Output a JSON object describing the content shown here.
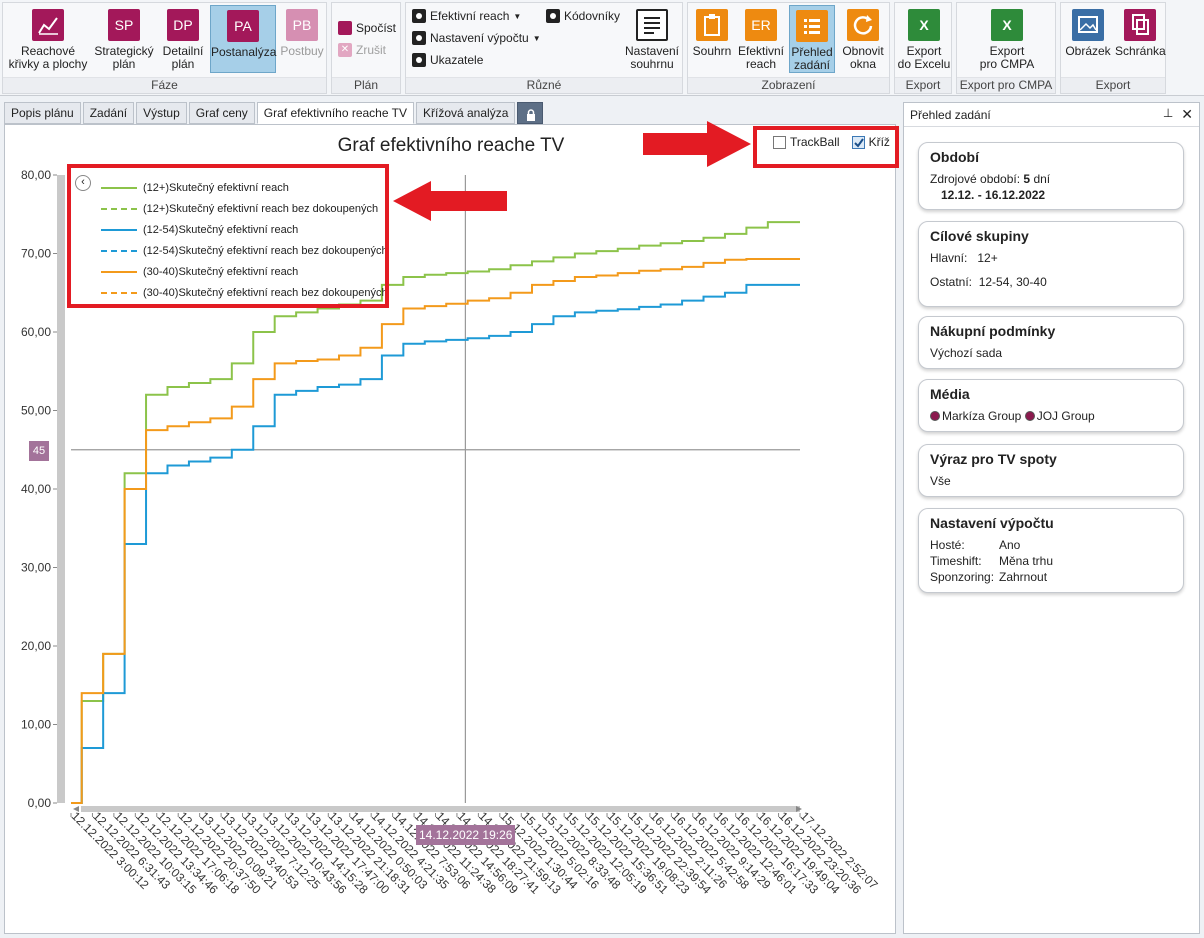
{
  "ribbon": {
    "groups": {
      "faze": "Fáze",
      "plan": "Plán",
      "ruzne": "Různé",
      "zobrazeni": "Zobrazení",
      "export1": "Export",
      "export_cmpa": "Export pro CMPA",
      "export2": "Export"
    },
    "reach_curves": {
      "line1": "Reachové",
      "line2": "křivky a plochy"
    },
    "strategic": {
      "code": "SP",
      "line1": "Strategický",
      "line2": "plán"
    },
    "detailed": {
      "code": "DP",
      "line1": "Detailní",
      "line2": "plán"
    },
    "postanalyza": {
      "code": "PA",
      "line1": "Postanalýza"
    },
    "postbuy": {
      "code": "PB",
      "line1": "Postbuy"
    },
    "spocist": "Spočíst",
    "zrusit": "Zrušit",
    "efektivni_reach": "Efektivní reach",
    "nastaveni_vypoctu": "Nastavení výpočtu",
    "ukazatele": "Ukazatele",
    "kodovniky": "Kódovníky",
    "nastaveni_souhrnu": {
      "line1": "Nastavení",
      "line2": "souhrnu"
    },
    "souhrn": "Souhrn",
    "efektivni_reach_view": {
      "code": "ER",
      "line1": "Efektivní",
      "line2": "reach"
    },
    "prehled_zadani": {
      "line1": "Přehled",
      "line2": "zadání"
    },
    "obnovit_okna": {
      "line1": "Obnovit",
      "line2": "okna"
    },
    "export_excel": {
      "line1": "Export",
      "line2": "do Excelu"
    },
    "export_cmpa_btn": {
      "line1": "Export",
      "line2": "pro CMPA"
    },
    "obrazek": "Obrázek",
    "schranka": "Schránka"
  },
  "tabs": [
    "Popis plánu",
    "Zadání",
    "Výstup",
    "Graf ceny",
    "Graf efektivního reache TV",
    "Křížová analýza"
  ],
  "chart_options": {
    "trackball": "TrackBall",
    "kriz": "Kříž",
    "trackball_checked": false,
    "kriz_checked": true
  },
  "crosshair": {
    "y_value": "45",
    "x_value": "14.12.2022 19:26"
  },
  "chart_data": {
    "type": "line",
    "title": "Graf efektivního reache TV",
    "ylim": [
      0,
      80
    ],
    "y_ticks": [
      "0,00",
      "10,00",
      "20,00",
      "30,00",
      "40,00",
      "50,00",
      "60,00",
      "70,00",
      "80,00"
    ],
    "x_tick_labels": [
      "12.12.2022 3:00:12",
      "12.12.2022 6:31:43",
      "12.12.2022 10:03:15",
      "12.12.2022 13:34:46",
      "12.12.2022 17:06:18",
      "12.12.2022 20:37:50",
      "13.12.2022 0:09:21",
      "13.12.2022 3:40:53",
      "13.12.2022 7:12:25",
      "13.12.2022 10:43:56",
      "13.12.2022 14:15:28",
      "13.12.2022 17:47:00",
      "13.12.2022 21:18:31",
      "14.12.2022 0:50:03",
      "14.12.2022 4:21:35",
      "14.12.2022 7:53:06",
      "14.12.2022 11:24:38",
      "14.12.2022 14:56:09",
      "14.12.2022 18:27:41",
      "14.12.2022 21:59:13",
      "15.12.2022 1:30:44",
      "15.12.2022 5:02:16",
      "15.12.2022 8:33:48",
      "15.12.2022 12:05:19",
      "15.12.2022 15:36:51",
      "15.12.2022 19:08:23",
      "15.12.2022 22:39:54",
      "16.12.2022 2:11:26",
      "16.12.2022 5:42:58",
      "16.12.2022 9:14:29",
      "16.12.2022 12:46:01",
      "16.12.2022 16:17:33",
      "16.12.2022 19:49:04",
      "16.12.2022 23:20:36",
      "17.12.2022 2:52:07"
    ],
    "series": [
      {
        "name": "(12+)Skutečný efektivní reach",
        "color": "#8cc34a",
        "dashed": false,
        "x": [
          0,
          1,
          2,
          3,
          4,
          5,
          6,
          7,
          8,
          9,
          10,
          11,
          12,
          13,
          14,
          15,
          16,
          17,
          18,
          19,
          20,
          21,
          22,
          23,
          24,
          25,
          26,
          27,
          28,
          29,
          30,
          31,
          32,
          33,
          34
        ],
        "values": [
          0,
          13,
          19,
          42,
          52,
          53,
          53.5,
          54,
          56,
          60,
          62,
          62.5,
          63,
          63.5,
          64,
          66,
          67,
          67.3,
          67.5,
          67.7,
          68,
          68.5,
          69,
          69.5,
          70,
          70.3,
          70.6,
          71,
          71.3,
          71.6,
          72,
          72.5,
          73.3,
          74,
          74
        ]
      },
      {
        "name": "(12+)Skutečný efektivní reach bez dokoupených",
        "color": "#8cc34a",
        "dashed": true,
        "values": []
      },
      {
        "name": "(12-54)Skutečný efektivní reach",
        "color": "#1e9ad6",
        "dashed": false,
        "x": [
          0,
          1,
          2,
          3,
          4,
          5,
          6,
          7,
          8,
          9,
          10,
          11,
          12,
          13,
          14,
          15,
          16,
          17,
          18,
          19,
          20,
          21,
          22,
          23,
          24,
          25,
          26,
          27,
          28,
          29,
          30,
          31,
          32,
          33,
          34
        ],
        "values": [
          0,
          7,
          14,
          33,
          42,
          43,
          43.5,
          44,
          45,
          48,
          52,
          52.5,
          53,
          53.3,
          54,
          57,
          58.5,
          58.8,
          59,
          59.2,
          59.5,
          60,
          61,
          62,
          62.5,
          62.7,
          62.9,
          63.2,
          63.5,
          64,
          64.5,
          65,
          66,
          66,
          66
        ]
      },
      {
        "name": "(12-54)Skutečný efektivní reach bez dokoupených",
        "color": "#1e9ad6",
        "dashed": true,
        "values": []
      },
      {
        "name": "(30-40)Skutečný efektivní reach",
        "color": "#f39a1b",
        "dashed": false,
        "x": [
          0,
          1,
          2,
          3,
          4,
          5,
          6,
          7,
          8,
          9,
          10,
          11,
          12,
          13,
          14,
          15,
          16,
          17,
          18,
          19,
          20,
          21,
          22,
          23,
          24,
          25,
          26,
          27,
          28,
          29,
          30,
          31,
          32,
          33,
          34
        ],
        "values": [
          0,
          14,
          19,
          40,
          47.5,
          48,
          48.5,
          49,
          50.5,
          54,
          56,
          56.3,
          56.5,
          57,
          58,
          61,
          63,
          63.3,
          63.6,
          64,
          64.3,
          65,
          66,
          66.5,
          67,
          67.2,
          67.5,
          67.8,
          68,
          68.3,
          68.8,
          69.2,
          69.3,
          69.3,
          69.3
        ]
      },
      {
        "name": "(30-40)Skutečný efektivní reach bez dokoupených",
        "color": "#f39a1b",
        "dashed": true,
        "values": []
      }
    ]
  },
  "overview": {
    "title": "Přehled zadání",
    "obdobi": {
      "title": "Období",
      "source_label": "Zdrojové období:",
      "days": "5",
      "days_unit": "dní",
      "range": "12.12. - 16.12.2022"
    },
    "cilove": {
      "title": "Cílové skupiny",
      "hlavni_label": "Hlavní:",
      "hlavni": "12+",
      "ostatni_label": "Ostatní:",
      "ostatni": "12-54, 30-40"
    },
    "nakupni": {
      "title": "Nákupní podmínky",
      "value": "Výchozí sada"
    },
    "media": {
      "title": "Média",
      "items": [
        "Markíza Group",
        "JOJ Group"
      ]
    },
    "vyraz": {
      "title": "Výraz pro TV spoty",
      "value": "Vše"
    },
    "nastaveni": {
      "title": "Nastavení výpočtu",
      "rows": [
        {
          "k": "Hosté:",
          "v": "Ano"
        },
        {
          "k": "Timeshift:",
          "v": "Měna trhu"
        },
        {
          "k": "Sponzoring:",
          "v": "Zahrnout"
        }
      ]
    }
  }
}
